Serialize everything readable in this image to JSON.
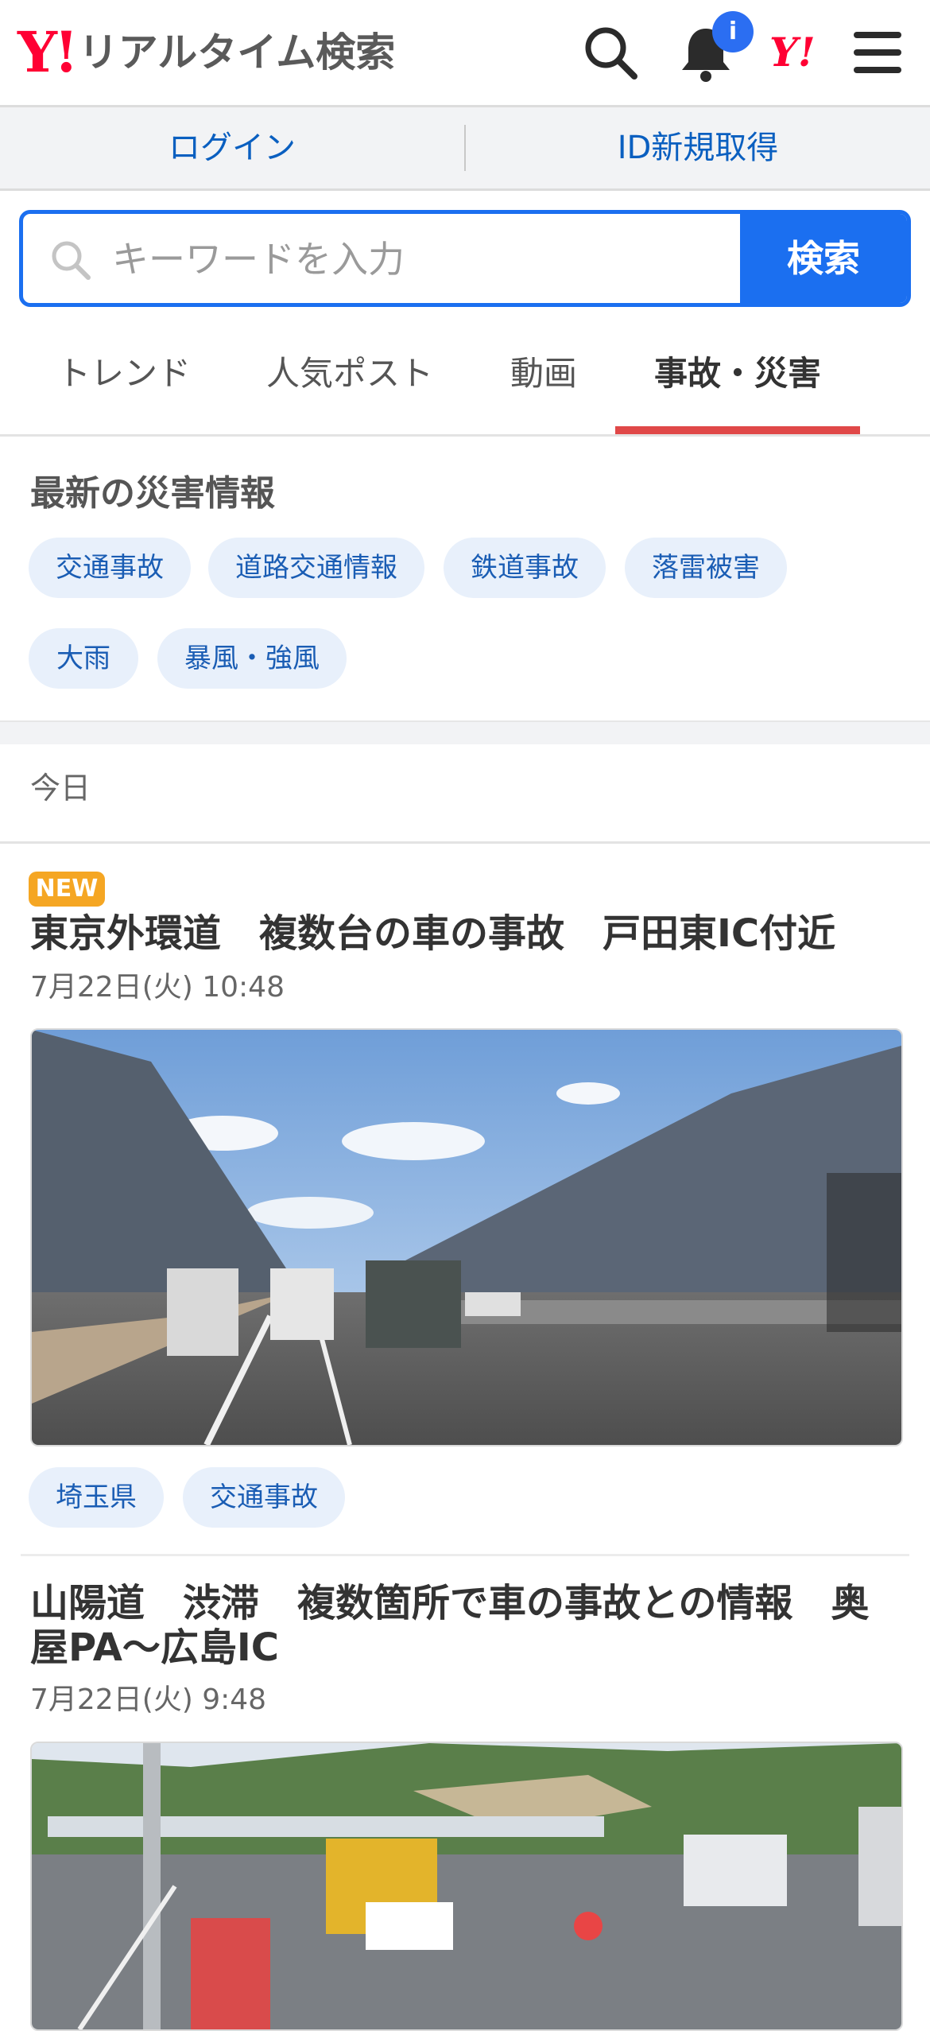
{
  "header": {
    "logo_mark": "Y!",
    "logo_text": "リアルタイム検索",
    "notification_badge": "i",
    "yahoo_icon_text": "Y!"
  },
  "auth": {
    "login_label": "ログイン",
    "register_label": "ID新規取得"
  },
  "search": {
    "placeholder": "キーワードを入力",
    "button_label": "検索"
  },
  "tabs": [
    {
      "label": "トレンド",
      "active": false
    },
    {
      "label": "人気ポスト",
      "active": false
    },
    {
      "label": "動画",
      "active": false
    },
    {
      "label": "事故・災害",
      "active": true
    }
  ],
  "disaster_section": {
    "title": "最新の災害情報",
    "chips": [
      "交通事故",
      "道路交通情報",
      "鉄道事故",
      "落雷被害",
      "大雨",
      "暴風・強風"
    ]
  },
  "day_label": "今日",
  "articles": [
    {
      "badge": "NEW",
      "title": "東京外環道　複数台の車の事故　戸田東IC付近",
      "date": "7月22日(火) 10:48",
      "tags": [
        "埼玉県",
        "交通事故"
      ]
    },
    {
      "title": "山陽道　渋滞　複数箇所で車の事故との情報　奥屋PA〜広島IC",
      "date": "7月22日(火) 9:48"
    }
  ],
  "colors": {
    "brand_red": "#ff0033",
    "accent_blue": "#1b6ff0",
    "link_blue": "#0a5fc0",
    "tab_active_underline": "#e04848",
    "chip_bg": "#e8f0fb",
    "new_badge": "#f5a623"
  },
  "icons": [
    "search-icon",
    "bell-icon",
    "yahoo-icon",
    "menu-icon"
  ]
}
